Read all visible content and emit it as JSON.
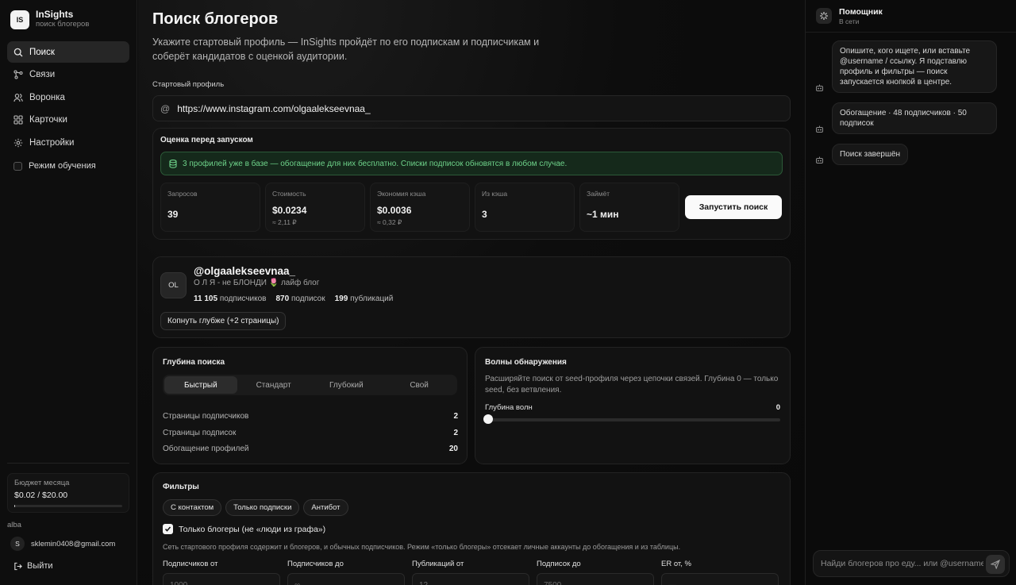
{
  "brand": {
    "logo": "IS",
    "name": "InSights",
    "subtitle": "поиск блогеров"
  },
  "sidebar": {
    "items": [
      {
        "label": "Поиск",
        "icon": "search-icon",
        "active": true
      },
      {
        "label": "Связи",
        "icon": "graph-icon"
      },
      {
        "label": "Воронка",
        "icon": "users-icon"
      },
      {
        "label": "Карточки",
        "icon": "grid-icon"
      },
      {
        "label": "Настройки",
        "icon": "gear-icon"
      }
    ],
    "learning_mode": "Режим обучения",
    "budget": {
      "title": "Бюджет месяца",
      "value": "$0.02 / $20.00",
      "progress": 0.001
    },
    "workspace": "alba",
    "user": {
      "initial": "S",
      "email": "sklemin0408@gmail.com"
    },
    "logout": "Выйти"
  },
  "main": {
    "title": "Поиск блогеров",
    "lead": "Укажите стартовый профиль — InSights пройдёт по его подпискам и подписчикам и соберёт кандидатов с оценкой аудитории.",
    "start_label": "Стартовый профиль",
    "start_value": "https://www.instagram.com/olgaalekseevnaa_",
    "estimate": {
      "title": "Оценка перед запуском",
      "alert": "3 профилей уже в базе — обогащение для них бесплатно. Списки подписок обновятся в любом случае.",
      "stats": [
        {
          "k": "Запросов",
          "v": "39",
          "s": ""
        },
        {
          "k": "Стоимость",
          "v": "$0.0234",
          "s": "≈ 2,11 ₽"
        },
        {
          "k": "Экономия кэша",
          "v": "$0.0036",
          "s": "≈ 0,32 ₽"
        },
        {
          "k": "Из кэша",
          "v": "3",
          "s": ""
        },
        {
          "k": "Займёт",
          "v": "~1 мин",
          "s": ""
        }
      ],
      "launch": "Запустить поиск"
    },
    "profile": {
      "avatar": "OL",
      "handle": "@olgaalekseevnaa_",
      "bio": "О Л Я - не БЛОНДИ 🌷 лайф блог",
      "followers_n": "11 105",
      "followers_l": "подписчиков",
      "following_n": "870",
      "following_l": "подписок",
      "posts_n": "199",
      "posts_l": "публикаций",
      "deeper": "Копнуть глубже (+2 страницы)"
    },
    "depth": {
      "title": "Глубина поиска",
      "options": [
        "Быстрый",
        "Стандарт",
        "Глубокий",
        "Свой"
      ],
      "selected": 0,
      "rows": [
        {
          "k": "Страницы подписчиков",
          "v": "2"
        },
        {
          "k": "Страницы подписок",
          "v": "2"
        },
        {
          "k": "Обогащение профилей",
          "v": "20"
        }
      ]
    },
    "waves": {
      "title": "Волны обнаружения",
      "desc": "Расширяйте поиск от seed-профиля через цепочки связей. Глубина 0 — только seed, без ветвления.",
      "label": "Глубина волн",
      "value": "0"
    },
    "filters": {
      "title": "Фильтры",
      "chips": [
        "С контактом",
        "Только подписки",
        "Антибот"
      ],
      "only_bloggers": "Только блогеры (не «люди из графа»)",
      "note": "Сеть стартового профиля содержит и блогеров, и обычных подписчиков. Режим «только блогеры» отсекает личные аккаунты до обогащения и из таблицы.",
      "fields": [
        {
          "label": "Подписчиков от",
          "placeholder": "1000"
        },
        {
          "label": "Подписчиков до",
          "placeholder": "∞"
        },
        {
          "label": "Публикаций от",
          "placeholder": "12"
        },
        {
          "label": "Подписок до",
          "placeholder": "7500"
        },
        {
          "label": "ER от, %",
          "placeholder": "—"
        }
      ]
    }
  },
  "chat": {
    "title": "Помощник",
    "status": "В сети",
    "messages": [
      "Опишите, кого ищете, или вставьте @username / ссылку. Я подставлю профиль и фильтры — поиск запускается кнопкой в центре.",
      "Обогащение · 48 подписчиков · 50 подписок",
      "Поиск завершён"
    ],
    "input_placeholder": "Найди блогеров про еду... или @username"
  }
}
